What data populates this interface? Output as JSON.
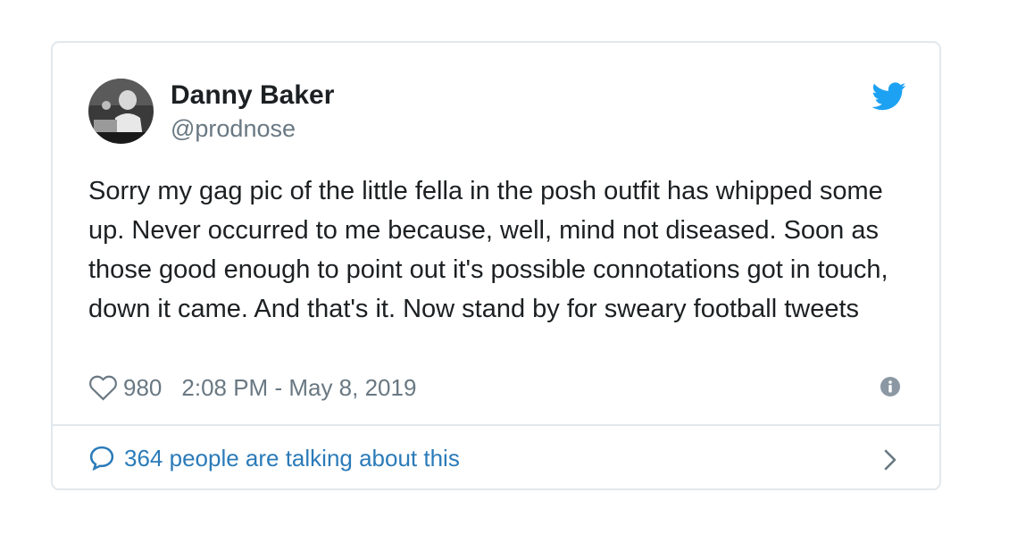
{
  "author": {
    "name": "Danny Baker",
    "handle": "@prodnose"
  },
  "tweet": {
    "text": "Sorry my gag pic of the little fella in the posh outfit has whipped some up. Never occurred to me because, well, mind not diseased. Soon as those good enough to point out it's possible connotations got in touch, down it came. And that's it. Now stand by for sweary football tweets",
    "likes": "980",
    "timestamp": "2:08 PM - May 8, 2019"
  },
  "footer": {
    "talking_label": "364 people are talking about this"
  },
  "icons": {
    "brand": "twitter-bird-icon",
    "like": "heart-icon",
    "info": "info-icon",
    "reply": "speech-bubble-icon",
    "more": "chevron-right-icon"
  },
  "colors": {
    "brand_blue": "#1da1f2",
    "link_blue": "#2b7bb9",
    "text": "#1c2022",
    "muted": "#697882",
    "border": "#e1e8ed"
  }
}
